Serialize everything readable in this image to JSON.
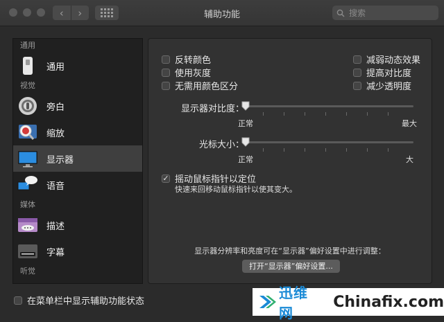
{
  "window": {
    "title": "辅助功能"
  },
  "search": {
    "placeholder": "搜索"
  },
  "sidebar": {
    "sections": [
      {
        "label": "通用",
        "items": [
          {
            "label": "通用",
            "icon": "general-switch-icon"
          }
        ]
      },
      {
        "label": "视觉",
        "items": [
          {
            "label": "旁白",
            "icon": "voiceover-icon"
          },
          {
            "label": "缩放",
            "icon": "zoom-icon"
          },
          {
            "label": "显示器",
            "icon": "display-icon",
            "selected": true
          },
          {
            "label": "语音",
            "icon": "speech-icon"
          }
        ]
      },
      {
        "label": "媒体",
        "items": [
          {
            "label": "描述",
            "icon": "descriptions-icon"
          },
          {
            "label": "字幕",
            "icon": "captions-icon"
          }
        ]
      },
      {
        "label": "听觉",
        "items": []
      }
    ]
  },
  "panel": {
    "options_left": [
      {
        "label": "反转颜色",
        "checked": false
      },
      {
        "label": "使用灰度",
        "checked": false
      },
      {
        "label": "无需用颜色区分",
        "checked": false
      }
    ],
    "options_right": [
      {
        "label": "减弱动态效果",
        "checked": false
      },
      {
        "label": "提高对比度",
        "checked": false
      },
      {
        "label": "减少透明度",
        "checked": false
      }
    ],
    "contrast": {
      "label": "显示器对比度：",
      "min_label": "正常",
      "max_label": "最大",
      "value": 0
    },
    "cursor": {
      "label": "光标大小：",
      "min_label": "正常",
      "max_label": "大",
      "value": 0
    },
    "shake": {
      "label": "摇动鼠标指针以定位",
      "checked": true,
      "description": "快速来回移动鼠标指针以使其变大。"
    },
    "note": "显示器分辨率和亮度可在“显示器”偏好设置中进行调整：",
    "open_button": "打开“显示器”偏好设置..."
  },
  "footer": {
    "menu_bar_label": "在菜单栏中显示辅助功能状态",
    "checked": false
  },
  "watermark": {
    "cn": "迅维网",
    "en": "Chinafix.com"
  },
  "colors": {
    "window_bg": "#2b2b2b",
    "sidebar_bg": "#202020",
    "panel_bg": "#323232",
    "selected_row": "#3f3f3f",
    "watermark_blue": "#1a8ad6"
  }
}
